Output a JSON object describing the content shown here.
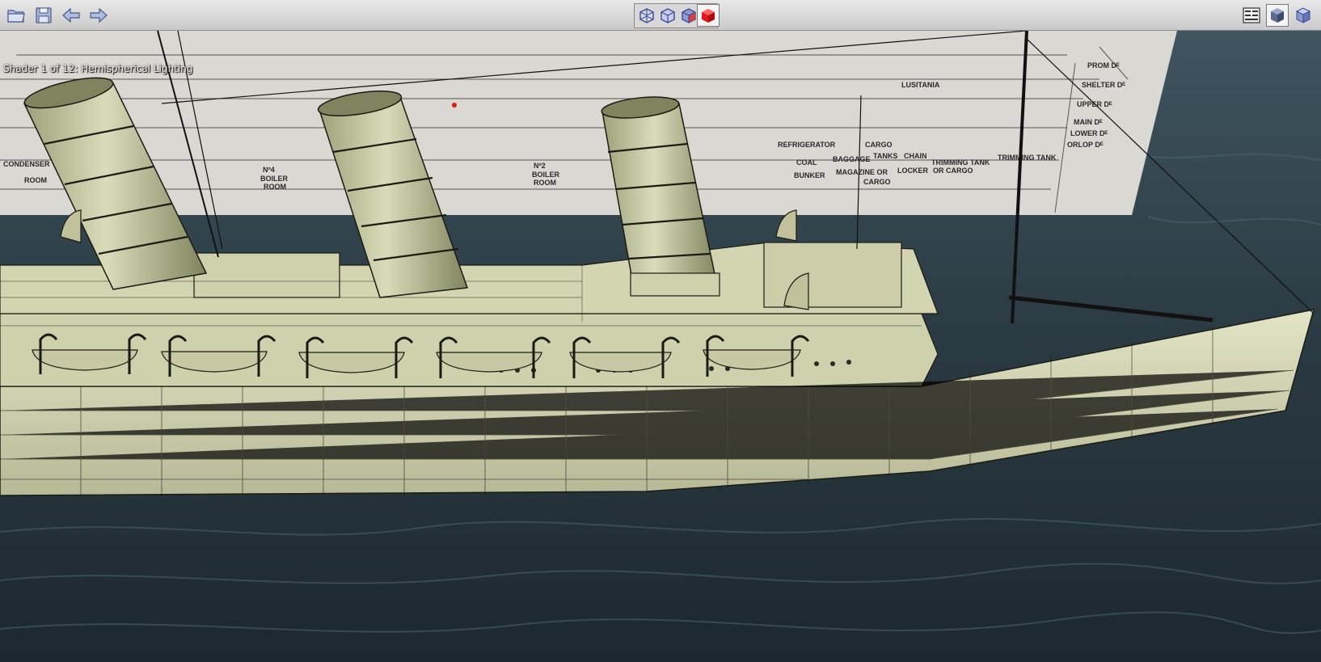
{
  "window": {
    "title": ""
  },
  "status": {
    "shader_text": "Shader 1 of 12: Hemispherical Lighting"
  },
  "toolbar": {
    "left_buttons": [
      {
        "name": "open-folder",
        "icon": "folder-icon"
      },
      {
        "name": "save",
        "icon": "floppy-disk-icon"
      },
      {
        "name": "back",
        "icon": "arrow-left-icon"
      },
      {
        "name": "forward",
        "icon": "arrow-right-icon"
      }
    ],
    "view_modes": [
      {
        "name": "wireframe-view",
        "icon": "wireframe-cube-icon"
      },
      {
        "name": "hidden-line-view",
        "icon": "hidden-line-cube-icon"
      },
      {
        "name": "shaded-wire-view",
        "icon": "shaded-wire-cube-icon"
      },
      {
        "name": "solid-view",
        "icon": "solid-red-cube-icon",
        "selected": true
      }
    ],
    "right_buttons": [
      {
        "name": "properties-panel",
        "icon": "panel-icon"
      },
      {
        "name": "shading-toggle",
        "icon": "shaded-cube-icon"
      },
      {
        "name": "object-view",
        "icon": "cube-icon"
      }
    ]
  },
  "scene": {
    "model": "ocean liner wireframe over shaded hull",
    "blueprint_labels": [
      "CONDENSER",
      "ROOM",
      "Nº4",
      "BOILER",
      "ROOM",
      "Nº2",
      "BOILER",
      "ROOM",
      "REFRIGERATOR",
      "CARGO",
      "COAL",
      "BAGGAGE",
      "TANKS",
      "CHAIN",
      "TRIMMING TANK",
      "TRIMMING TANK",
      "BUNKER",
      "MAGAZINE OR",
      "LOCKER",
      "OR CARGO",
      "CARGO",
      "LUSITANIA",
      "PROM Dᴱ",
      "SHELTER Dᴱ",
      "UPPER Dᴱ",
      "MAIN Dᴱ",
      "LOWER Dᴱ",
      "ORLOP Dᴱ"
    ],
    "colors": {
      "water_dark": "#1f2c33",
      "water_light": "#3f5560",
      "hull": "#d6d7b4",
      "hull_shadow": "#b9bb95",
      "blueprint": "#d9d8d2",
      "wire": "#1b1b14",
      "accent_red": "#e01818"
    }
  }
}
